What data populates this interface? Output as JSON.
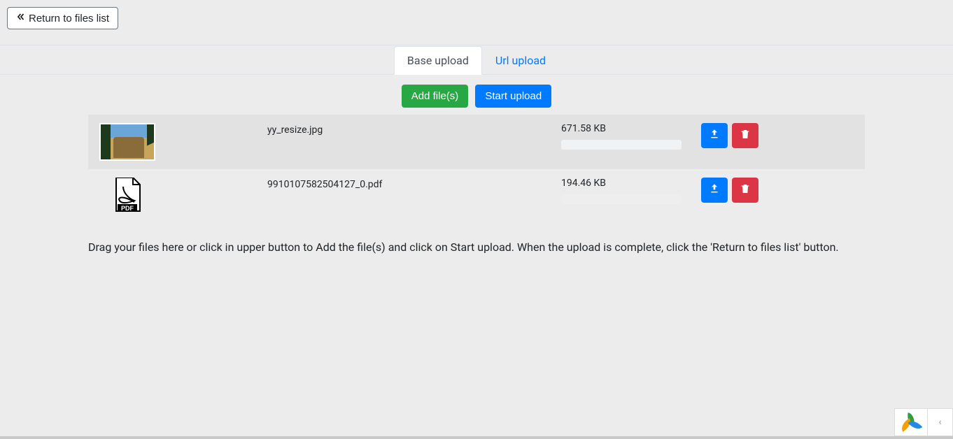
{
  "header": {
    "return_label": "Return to files list"
  },
  "tabs": {
    "base": "Base upload",
    "url": "Url upload"
  },
  "actions": {
    "add": "Add file(s)",
    "start": "Start upload"
  },
  "files": [
    {
      "name": "yy_resize.jpg",
      "size": "671.58 KB",
      "type": "image"
    },
    {
      "name": "9910107582504127_0.pdf",
      "size": "194.46 KB",
      "type": "pdf"
    }
  ],
  "help_text": "Drag your files here or click in upper button to Add the file(s) and click on Start upload. When the upload is complete, click the 'Return to files list' button."
}
